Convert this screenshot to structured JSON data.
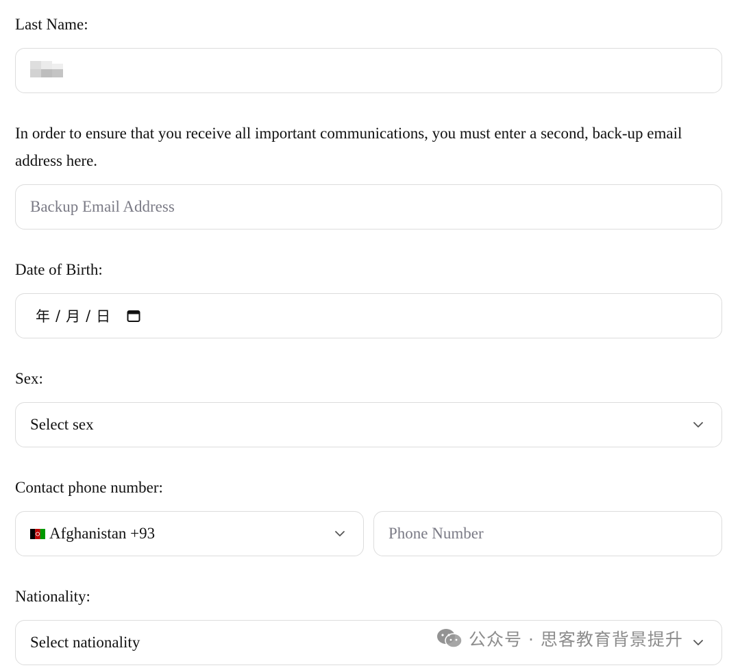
{
  "last_name": {
    "label": "Last Name:",
    "value_redacted": true
  },
  "backup_email": {
    "instructions": "In order to ensure that you receive all important communications, you must enter a second, back-up email address here.",
    "placeholder": "Backup Email Address"
  },
  "date_of_birth": {
    "label": "Date of Birth:",
    "year_placeholder": "年",
    "month_placeholder": "月",
    "day_placeholder": "日",
    "separator": "/",
    "icon": "calendar-icon"
  },
  "sex": {
    "label": "Sex:",
    "selected": "Select sex",
    "icon": "chevron-down-icon"
  },
  "contact_phone": {
    "label": "Contact phone number:",
    "country_selected": "Afghanistan +93",
    "country_flag": "afghanistan-flag-icon",
    "phone_placeholder": "Phone Number"
  },
  "nationality": {
    "label": "Nationality:",
    "selected": "Select nationality"
  },
  "watermark": {
    "text": "公众号 · 思客教育背景提升",
    "icon": "wechat-icon"
  },
  "colors": {
    "border": "#dcdcdc",
    "placeholder": "#7a7a85",
    "text": "#111111"
  }
}
